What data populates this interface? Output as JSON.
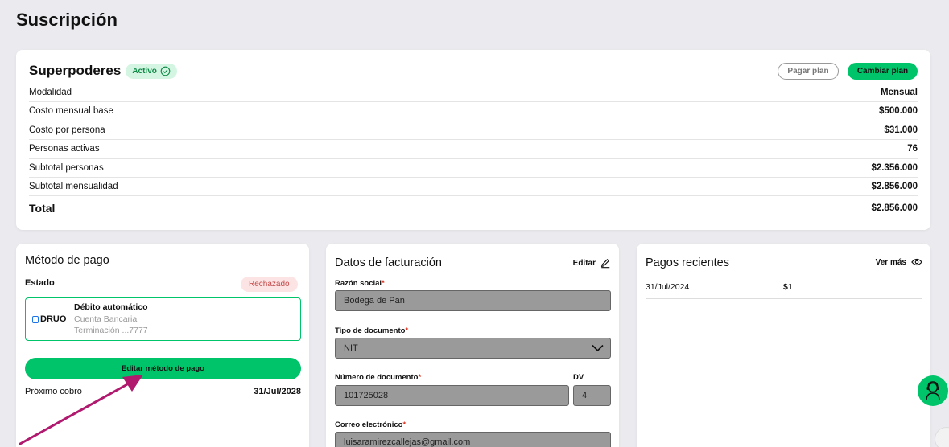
{
  "page_title": "Suscripción",
  "subscription": {
    "name": "Superpoderes",
    "status": "Activo",
    "pay_button": "Pagar plan",
    "change_button": "Cambiar plan",
    "rows": [
      {
        "label": "Modalidad",
        "value": "Mensual"
      },
      {
        "label": "Costo mensual base",
        "value": "$500.000"
      },
      {
        "label": "Costo por persona",
        "value": "$31.000"
      },
      {
        "label": "Personas activas",
        "value": "76"
      },
      {
        "label": "Subtotal personas",
        "value": "$2.356.000"
      },
      {
        "label": "Subtotal mensualidad",
        "value": "$2.856.000"
      }
    ],
    "total_label": "Total",
    "total_value": "$2.856.000"
  },
  "payment_method": {
    "title": "Método de pago",
    "estado_label": "Estado",
    "status": "Rechazado",
    "provider": "DRUO",
    "method_title": "Débito automático",
    "account_type": "Cuenta Bancaria",
    "termination": "Terminación ...7777",
    "edit_button": "Editar método de pago",
    "next_charge_label": "Próximo cobro",
    "next_charge_date": "31/Jul/2028"
  },
  "billing": {
    "title": "Datos de facturación",
    "edit_label": "Editar",
    "razon_label": "Razón social",
    "razon_value": "Bodega de Pan",
    "tipo_label": "Tipo de documento",
    "tipo_value": "NIT",
    "numero_label": "Número de documento",
    "numero_value": "101725028",
    "dv_label": "DV",
    "dv_value": "4",
    "correo_label": "Correo electrónico",
    "correo_value": "luisaramirezcallejas@gmail.com",
    "required_mark": "*"
  },
  "recent_payments": {
    "title": "Pagos recientes",
    "more_label": "Ver más",
    "items": [
      {
        "date": "31/Jul/2024",
        "amount": "$1"
      }
    ]
  },
  "colors": {
    "accent_green": "#00c46a",
    "annotation_arrow": "#b0196e"
  }
}
